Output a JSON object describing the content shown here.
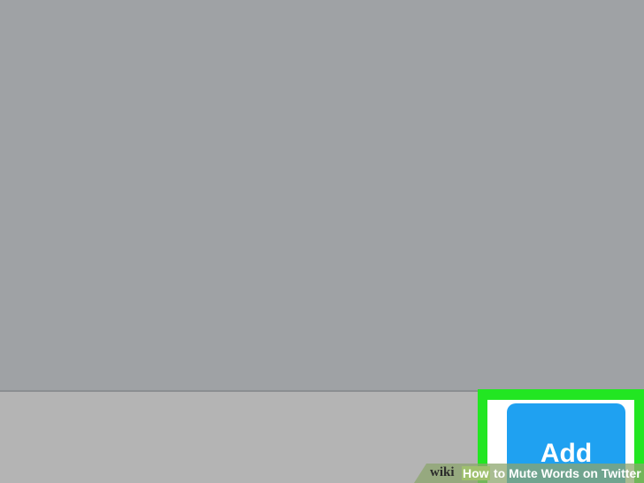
{
  "screen": {
    "background_color": "#9fa2a5",
    "bottom_bar_color": "#b4b4b4"
  },
  "add_button": {
    "label": "Add",
    "color": "#1fa1f1"
  },
  "highlight": {
    "color": "#22e622"
  },
  "watermark": {
    "brand": "wiki",
    "how": "How",
    "title": " to Mute Words on Twitter"
  }
}
